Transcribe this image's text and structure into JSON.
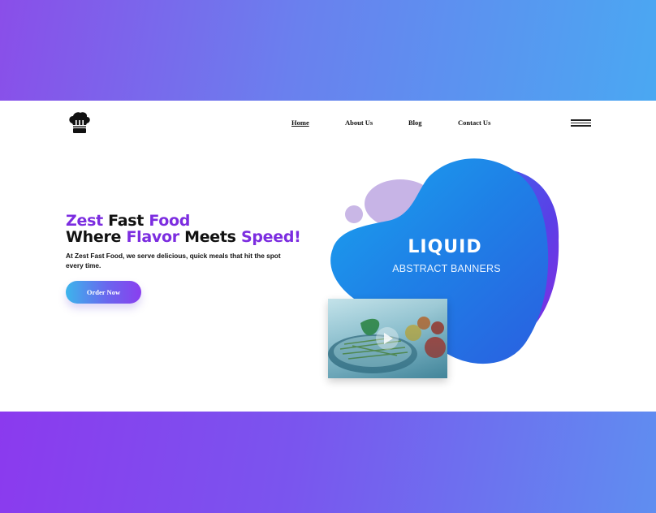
{
  "nav": {
    "items": [
      "Home",
      "About Us",
      "Blog",
      "Contact Us"
    ]
  },
  "hero": {
    "headline_line1": [
      {
        "text": "Zest",
        "accent": true
      },
      {
        "text": " Fast ",
        "accent": false
      },
      {
        "text": "Food",
        "accent": true
      }
    ],
    "headline_line2": [
      {
        "text": "Where ",
        "accent": false
      },
      {
        "text": "Flavor",
        "accent": true
      },
      {
        "text": " Meets ",
        "accent": false
      },
      {
        "text": "Speed!",
        "accent": true
      }
    ],
    "subtext": "At Zest Fast Food, we serve delicious, quick meals that hit the spot every time.",
    "cta_label": "Order Now"
  },
  "banner": {
    "title": "LIQUID",
    "subtitle": "ABSTRACT BANNERS"
  },
  "icons": {
    "logo": "chef-hat-icon",
    "menu": "hamburger-menu-icon",
    "play": "play-icon"
  },
  "colors": {
    "accent_purple": "#7c2de0",
    "gradient_blue": "#3cb5ec",
    "gradient_purple": "#8a3fef",
    "blob_blue": "#1f7fe6"
  }
}
